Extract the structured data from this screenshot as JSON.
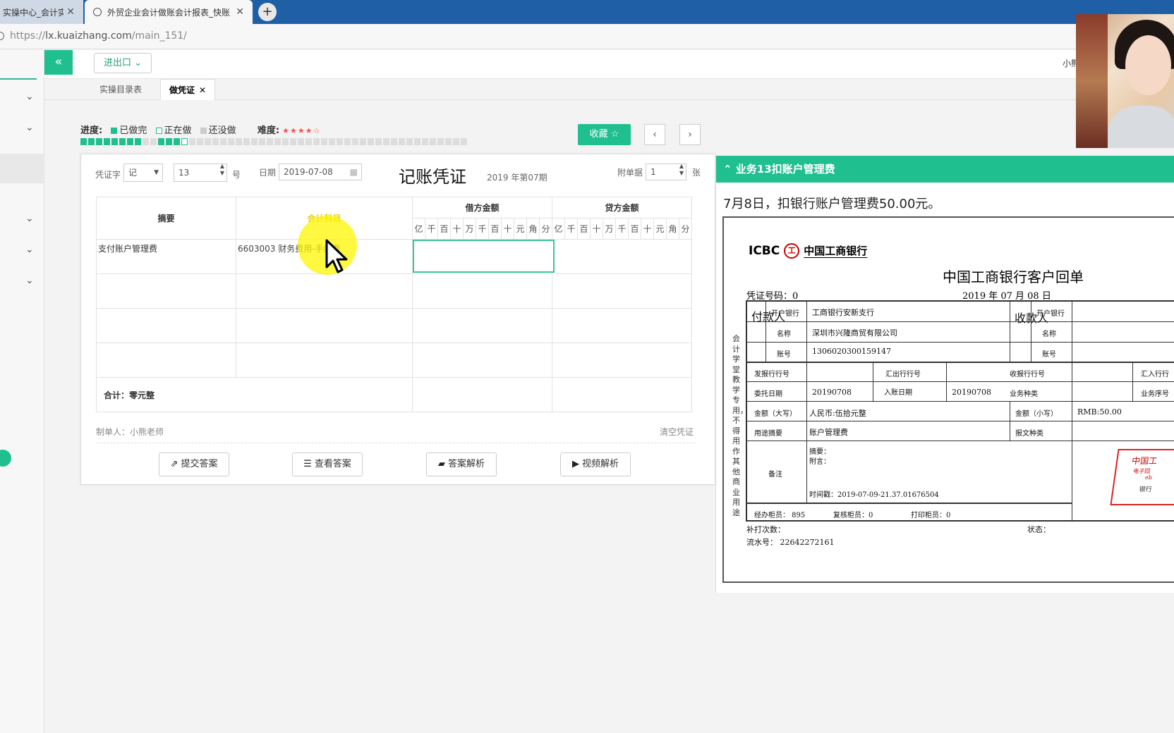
{
  "browser": {
    "tab1_title": "实操中心_会计实操",
    "tab2_title": "外贸企业会计做账会计报表_快账",
    "url_prefix": "https://",
    "url_host": "lx.kuaizhang.com",
    "url_path": "/main_151/"
  },
  "topbar": {
    "collapse_label": "«",
    "menu_label": "进出口",
    "user": "小熊"
  },
  "page_tabs": [
    {
      "label": "实操目录表"
    },
    {
      "label": "做凭证"
    }
  ],
  "progress": {
    "label": "进度:",
    "done": "已做完",
    "doing": "正在做",
    "todo": "还没做",
    "difficulty_label": "难度:",
    "difficulty_stars": "★★★★☆",
    "done_count": 13,
    "total": 50
  },
  "buttons": {
    "favorite": "收藏 ☆",
    "prev": "‹",
    "next": "›",
    "submit": "提交答案",
    "view_answer": "查看答案",
    "analysis": "答案解析",
    "video": "视频解析"
  },
  "voucher": {
    "word_label": "凭证字",
    "word_value": "记",
    "number_value": "13",
    "number_unit": "号",
    "date_label": "日期",
    "date_value": "2019-07-08",
    "title": "记账凭证",
    "period": "2019 年第07期",
    "attach_label": "附单据",
    "attach_value": "1",
    "attach_unit": "张",
    "col_summary": "摘要",
    "col_account": "会计科目",
    "col_debit": "借方金额",
    "col_credit": "贷方金额",
    "digits": [
      "亿",
      "千",
      "百",
      "十",
      "万",
      "千",
      "百",
      "十",
      "元",
      "角",
      "分"
    ],
    "rows": [
      {
        "summary": "支付账户管理费",
        "account": "6603003 财务费用-手续费"
      }
    ],
    "total": "合计：零元整",
    "maker": "制单人：小熊老师",
    "clear": "清空凭证"
  },
  "task": {
    "header": "业务13扣账户管理费",
    "description": "7月8日，扣银行账户管理费50.00元。"
  },
  "receipt": {
    "logo": "ICBC",
    "bank": "中国工商银行",
    "title": "中国工商银行客户回单",
    "voucher_no": "凭证号码：0",
    "date": "2019 年   07 月   08  日",
    "vertical": "会计学堂教学专用，不得用作其他商业用途",
    "payer": "付款人",
    "payee": "收款人",
    "open_bank": "开户银行",
    "payer_bank": "工商银行安新支行",
    "name": "名称",
    "payer_name": "深圳市兴隆商贸有限公司",
    "account": "账号",
    "payer_account": "1306020300159147",
    "send_bank_no": "发报行行号",
    "remit_bank_no": "汇出行行号",
    "recv_bank_no": "收报行行号",
    "in_bank_no": "汇入行行",
    "entrust_date": "委托日期",
    "entrust_value": "20190708",
    "in_date": "入账日期",
    "in_value": "20190708",
    "biz_type": "业务种类",
    "biz_seq": "业务序号",
    "amount_big": "金额（大写）",
    "amount_big_value": "人民币:伍拾元整",
    "amount_small": "金额（小写）",
    "amount_small_value": "RMB:50.00",
    "purpose": "用途摘要",
    "purpose_value": "账户管理费",
    "msg_type": "报文种类",
    "remark": "备注",
    "summary_label": "摘要：",
    "postscript": "附言：",
    "timestamp": "时间戳：2019-07-09-21.37.01676504",
    "teller": "经办柜员：  895",
    "reviewer": "复核柜员：0",
    "printer": "打印柜员：0",
    "reprint": "补打次数：",
    "status": "状态：",
    "serial": "流水号：  22642272161",
    "stamp_line1": "中国工",
    "stamp_line2": "电子回",
    "stamp_line3": "eb",
    "stamp_line4": "银行"
  }
}
